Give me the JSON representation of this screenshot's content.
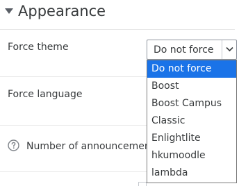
{
  "section": {
    "title": "Appearance",
    "collapse_icon": "chevron-down-icon"
  },
  "fields": {
    "force_theme": {
      "label": "Force theme"
    },
    "force_language": {
      "label": "Force language"
    },
    "announcements": {
      "label": "Number of announcements",
      "help_icon": "question-circle-icon"
    }
  },
  "theme_select": {
    "selected": "Do not force",
    "options": [
      "Do not force",
      "Boost",
      "Boost Campus",
      "Classic",
      "Enlightlite",
      "hkumoodle",
      "lambda"
    ],
    "highlighted_index": 0,
    "highlight_color": "#1a73e8"
  }
}
